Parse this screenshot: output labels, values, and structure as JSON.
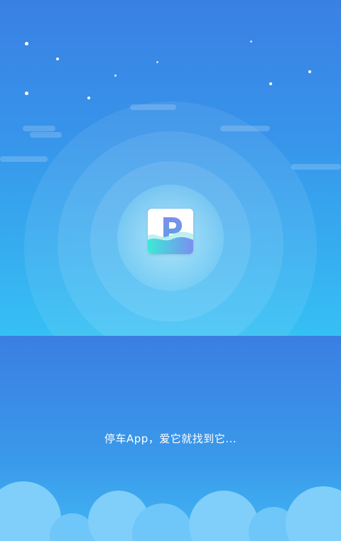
{
  "app": {
    "slogan": "停车App，爱它就找到它...",
    "logo_icon": "parking-p-logo-icon"
  },
  "colors": {
    "sky_top": "#3a80e4",
    "sky_bottom": "#36c0f4",
    "slogan_text": "#ffffff",
    "cloud": "#74c9f9"
  }
}
